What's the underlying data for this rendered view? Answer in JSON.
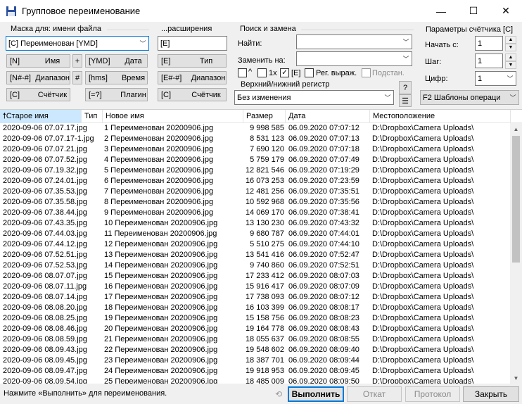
{
  "window": {
    "title": "Групповое переименование",
    "minimize": "—",
    "maximize": "☐",
    "close": "✕"
  },
  "mask": {
    "group_label": "Маска для: имени файла",
    "value": "[C] Переименован  [YMD]",
    "buttons": [
      {
        "code": "[N]",
        "label": "Имя"
      },
      {
        "code": "[N#-#]",
        "label": "Диапазон"
      },
      {
        "code": "[C]",
        "label": "Счётчик"
      }
    ],
    "plus": "+",
    "hash": "#",
    "buttons2": [
      {
        "code": "[YMD]",
        "label": "Дата"
      },
      {
        "code": "[hms]",
        "label": "Время"
      },
      {
        "code": "[=?]",
        "label": "Плагин"
      }
    ]
  },
  "ext": {
    "group_label": "...расширения",
    "value": "[E]",
    "buttons": [
      {
        "code": "[E]",
        "label": "Тип"
      },
      {
        "code": "[E#-#]",
        "label": "Диапазон"
      },
      {
        "code": "[C]",
        "label": "Счётчик"
      }
    ]
  },
  "search": {
    "group_label": "Поиск и замена",
    "find_label": "Найти:",
    "find_value": "",
    "replace_label": "Заменить на:",
    "replace_value": "",
    "opt_case": "^",
    "opt_once": "1x",
    "opt_ext": "[E]",
    "opt_regex": "Рег. выраж.",
    "opt_subst": "Подстан.",
    "help": "?",
    "case_group_label": "Верхний/нижний регистр",
    "case_value": "Без изменения"
  },
  "counter": {
    "group_label": "Параметры счётчика [C]",
    "start_label": "Начать с:",
    "start_value": "1",
    "step_label": "Шаг:",
    "step_value": "1",
    "digits_label": "Цифр:",
    "digits_value": "1",
    "templates": "F2 Шаблоны операци"
  },
  "table": {
    "columns": {
      "old": "Старое имя",
      "type": "Тип",
      "new": "Новое имя",
      "size": "Размер",
      "date": "Дата",
      "location": "Местоположение"
    },
    "rows": [
      [
        "2020-09-06 07.07.17.jpg",
        "1 Переименован  20200906.jpg",
        "9 998 585",
        "06.09.2020 07:07:12",
        "D:\\Dropbox\\Camera Uploads\\"
      ],
      [
        "2020-09-06 07.07.17-1.jpg",
        "2 Переименован  20200906.jpg",
        "8 531 123",
        "06.09.2020 07:07:13",
        "D:\\Dropbox\\Camera Uploads\\"
      ],
      [
        "2020-09-06 07.07.21.jpg",
        "3 Переименован  20200906.jpg",
        "7 690 120",
        "06.09.2020 07:07:18",
        "D:\\Dropbox\\Camera Uploads\\"
      ],
      [
        "2020-09-06 07.07.52.jpg",
        "4 Переименован  20200906.jpg",
        "5 759 179",
        "06.09.2020 07:07:49",
        "D:\\Dropbox\\Camera Uploads\\"
      ],
      [
        "2020-09-06 07.19.32.jpg",
        "5 Переименован  20200906.jpg",
        "12 821 546",
        "06.09.2020 07:19:29",
        "D:\\Dropbox\\Camera Uploads\\"
      ],
      [
        "2020-09-06 07.24.01.jpg",
        "6 Переименован  20200906.jpg",
        "16 073 253",
        "06.09.2020 07:23:59",
        "D:\\Dropbox\\Camera Uploads\\"
      ],
      [
        "2020-09-06 07.35.53.jpg",
        "7 Переименован  20200906.jpg",
        "12 481 256",
        "06.09.2020 07:35:51",
        "D:\\Dropbox\\Camera Uploads\\"
      ],
      [
        "2020-09-06 07.35.58.jpg",
        "8 Переименован  20200906.jpg",
        "10 592 968",
        "06.09.2020 07:35:56",
        "D:\\Dropbox\\Camera Uploads\\"
      ],
      [
        "2020-09-06 07.38.44.jpg",
        "9 Переименован  20200906.jpg",
        "14 069 170",
        "06.09.2020 07:38:41",
        "D:\\Dropbox\\Camera Uploads\\"
      ],
      [
        "2020-09-06 07.43.35.jpg",
        "10 Переименован  20200906.jpg",
        "13 130 230",
        "06.09.2020 07:43:32",
        "D:\\Dropbox\\Camera Uploads\\"
      ],
      [
        "2020-09-06 07.44.03.jpg",
        "11 Переименован  20200906.jpg",
        "9 680 787",
        "06.09.2020 07:44:01",
        "D:\\Dropbox\\Camera Uploads\\"
      ],
      [
        "2020-09-06 07.44.12.jpg",
        "12 Переименован  20200906.jpg",
        "5 510 275",
        "06.09.2020 07:44:10",
        "D:\\Dropbox\\Camera Uploads\\"
      ],
      [
        "2020-09-06 07.52.51.jpg",
        "13 Переименован  20200906.jpg",
        "13 541 416",
        "06.09.2020 07:52:47",
        "D:\\Dropbox\\Camera Uploads\\"
      ],
      [
        "2020-09-06 07.52.53.jpg",
        "14 Переименован  20200906.jpg",
        "9 740 860",
        "06.09.2020 07:52:51",
        "D:\\Dropbox\\Camera Uploads\\"
      ],
      [
        "2020-09-06 08.07.07.jpg",
        "15 Переименован  20200906.jpg",
        "17 233 412",
        "06.09.2020 08:07:03",
        "D:\\Dropbox\\Camera Uploads\\"
      ],
      [
        "2020-09-06 08.07.11.jpg",
        "16 Переименован  20200906.jpg",
        "15 916 417",
        "06.09.2020 08:07:09",
        "D:\\Dropbox\\Camera Uploads\\"
      ],
      [
        "2020-09-06 08.07.14.jpg",
        "17 Переименован  20200906.jpg",
        "17 738 093",
        "06.09.2020 08:07:12",
        "D:\\Dropbox\\Camera Uploads\\"
      ],
      [
        "2020-09-06 08.08.20.jpg",
        "18 Переименован  20200906.jpg",
        "16 103 399",
        "06.09.2020 08:08:17",
        "D:\\Dropbox\\Camera Uploads\\"
      ],
      [
        "2020-09-06 08.08.25.jpg",
        "19 Переименован  20200906.jpg",
        "15 158 756",
        "06.09.2020 08:08:23",
        "D:\\Dropbox\\Camera Uploads\\"
      ],
      [
        "2020-09-06 08.08.46.jpg",
        "20 Переименован  20200906.jpg",
        "19 164 778",
        "06.09.2020 08:08:43",
        "D:\\Dropbox\\Camera Uploads\\"
      ],
      [
        "2020-09-06 08.08.59.jpg",
        "21 Переименован  20200906.jpg",
        "18 055 637",
        "06.09.2020 08:08:55",
        "D:\\Dropbox\\Camera Uploads\\"
      ],
      [
        "2020-09-06 08.09.43.jpg",
        "22 Переименован  20200906.jpg",
        "19 548 602",
        "06.09.2020 08:09:40",
        "D:\\Dropbox\\Camera Uploads\\"
      ],
      [
        "2020-09-06 08.09.45.jpg",
        "23 Переименован  20200906.jpg",
        "18 387 701",
        "06.09.2020 08:09:44",
        "D:\\Dropbox\\Camera Uploads\\"
      ],
      [
        "2020-09-06 08.09.47.jpg",
        "24 Переименован  20200906.jpg",
        "19 918 953",
        "06.09.2020 08:09:45",
        "D:\\Dropbox\\Camera Uploads\\"
      ],
      [
        "2020-09-06 08.09.54.jpg",
        "25 Переименован  20200906.jpg",
        "18 485 009",
        "06.09.2020 08:09:50",
        "D:\\Dropbox\\Camera Uploads\\"
      ]
    ]
  },
  "status": {
    "message": "Нажмите «Выполнить» для переименования.",
    "run": "Выполнить",
    "undo": "Откат",
    "log": "Протокол",
    "close": "Закрыть"
  },
  "colors": {
    "sort_header": "#cce8ff",
    "accent": "#0078d7"
  }
}
